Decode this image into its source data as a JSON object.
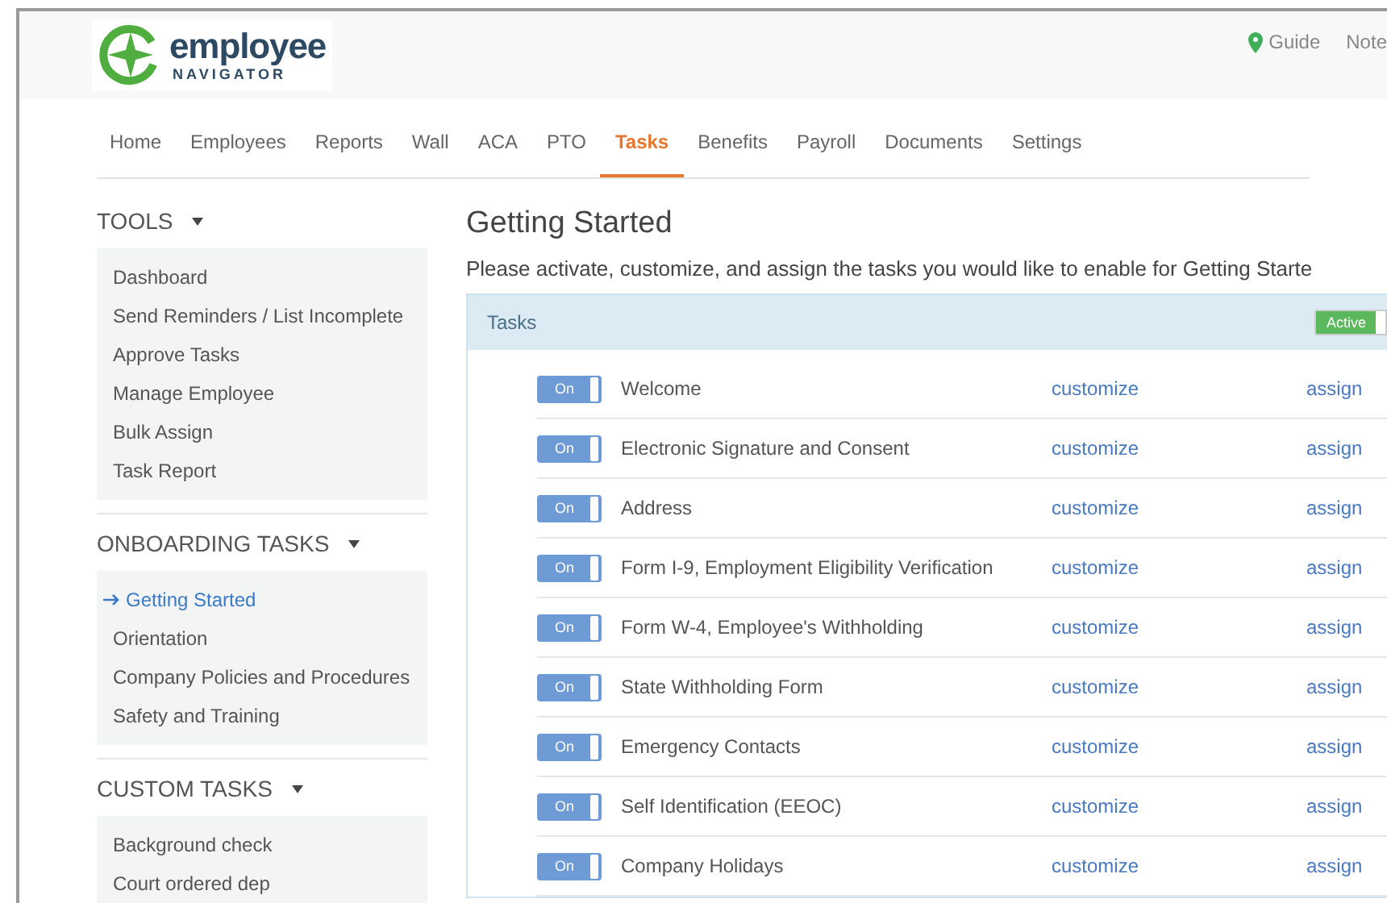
{
  "header": {
    "logo": {
      "word": "employee",
      "sub": "NAVIGATOR"
    },
    "links": [
      {
        "label": "Guide",
        "kind": "guide"
      },
      {
        "label": "Note",
        "kind": "plain"
      }
    ]
  },
  "nav": [
    {
      "label": "Home",
      "selected": false
    },
    {
      "label": "Employees",
      "selected": false
    },
    {
      "label": "Reports",
      "selected": false
    },
    {
      "label": "Wall",
      "selected": false
    },
    {
      "label": "ACA",
      "selected": false
    },
    {
      "label": "PTO",
      "selected": false
    },
    {
      "label": "Tasks",
      "selected": true
    },
    {
      "label": "Benefits",
      "selected": false
    },
    {
      "label": "Payroll",
      "selected": false
    },
    {
      "label": "Documents",
      "selected": false
    },
    {
      "label": "Settings",
      "selected": false
    }
  ],
  "sidebar": [
    {
      "title": "TOOLS",
      "items": [
        {
          "label": "Dashboard",
          "selected": false
        },
        {
          "label": "Send Reminders / List Incomplete",
          "selected": false
        },
        {
          "label": "Approve Tasks",
          "selected": false
        },
        {
          "label": "Manage Employee",
          "selected": false
        },
        {
          "label": "Bulk Assign",
          "selected": false
        },
        {
          "label": "Task Report",
          "selected": false
        }
      ]
    },
    {
      "title": "ONBOARDING TASKS",
      "items": [
        {
          "label": "Getting Started",
          "selected": true
        },
        {
          "label": "Orientation",
          "selected": false
        },
        {
          "label": "Company Policies and Procedures",
          "selected": false
        },
        {
          "label": "Safety and Training",
          "selected": false
        }
      ]
    },
    {
      "title": "CUSTOM TASKS",
      "items": [
        {
          "label": "Background check",
          "selected": false
        },
        {
          "label": "Court ordered dep",
          "selected": false
        }
      ]
    }
  ],
  "main": {
    "title": "Getting Started",
    "intro": "Please activate, customize, and assign the tasks you would like to enable for Getting Starte",
    "panel": {
      "title": "Tasks",
      "status": "Active",
      "active": true,
      "rows": [
        {
          "toggle": "On",
          "on": true,
          "name": "Welcome",
          "customize": "customize",
          "assign": "assign"
        },
        {
          "toggle": "On",
          "on": true,
          "name": "Electronic Signature and Consent",
          "customize": "customize",
          "assign": "assign"
        },
        {
          "toggle": "On",
          "on": true,
          "name": "Address",
          "customize": "customize",
          "assign": "assign"
        },
        {
          "toggle": "On",
          "on": true,
          "name": "Form I-9, Employment Eligibility Verification",
          "customize": "customize",
          "assign": "assign"
        },
        {
          "toggle": "On",
          "on": true,
          "name": "Form W-4, Employee's Withholding",
          "customize": "customize",
          "assign": "assign"
        },
        {
          "toggle": "On",
          "on": true,
          "name": "State Withholding Form",
          "customize": "customize",
          "assign": "assign"
        },
        {
          "toggle": "On",
          "on": true,
          "name": "Emergency Contacts",
          "customize": "customize",
          "assign": "assign"
        },
        {
          "toggle": "On",
          "on": true,
          "name": "Self Identification (EEOC)",
          "customize": "customize",
          "assign": "assign"
        },
        {
          "toggle": "On",
          "on": true,
          "name": "Company Holidays",
          "customize": "customize",
          "assign": "assign"
        }
      ]
    }
  }
}
